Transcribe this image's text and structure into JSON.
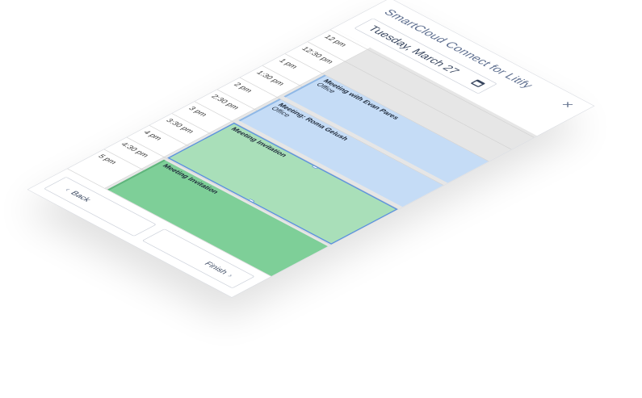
{
  "app": {
    "title": "SmartCloud Connect for Litify",
    "close_icon": "close-icon"
  },
  "date_picker": {
    "value": "Tuesday, March 27",
    "icon": "calendar-icon"
  },
  "time_slots": [
    "12 pm",
    "12:30 pm",
    "1 pm",
    "1:30 pm",
    "2 pm",
    "2:30 pm",
    "3 pm",
    "3:30 pm",
    "4 pm",
    "4:30 pm",
    "5 pm"
  ],
  "events": [
    {
      "title": "Meeting with Evan Pares",
      "location": "Office"
    },
    {
      "title": "Meeting: Roma Gelush",
      "location": "Office"
    },
    {
      "title": "Meeting Invitation",
      "location": ""
    },
    {
      "title": "Meeting Invitation",
      "location": ""
    }
  ],
  "footer": {
    "back_label": "Back",
    "back_icon": "chevron-left-icon",
    "finish_label": "Finish",
    "finish_icon": "chevron-right-icon"
  },
  "colors": {
    "event_blue": "#c5dcf6",
    "event_green_selected": "#a9dfb9",
    "event_green": "#7ecf98",
    "selection_border": "#5b8fe0"
  }
}
